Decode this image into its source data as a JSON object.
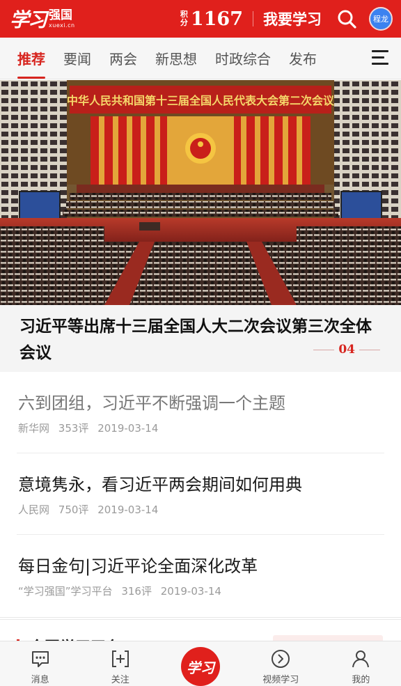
{
  "header": {
    "logo_script": "学习",
    "logo_main": "强国",
    "logo_sub": "xuexi.cn",
    "points_label_1": "积",
    "points_label_2": "分",
    "points_value": "1167",
    "study_label": "我要学习",
    "avatar_text": "程龙"
  },
  "tabs": [
    {
      "label": "推荐",
      "active": true
    },
    {
      "label": "要闻",
      "active": false
    },
    {
      "label": "两会",
      "active": false
    },
    {
      "label": "新思想",
      "active": false
    },
    {
      "label": "时政综合",
      "active": false
    },
    {
      "label": "发布",
      "active": false
    }
  ],
  "hero": {
    "banner_text": "中华人民共和国第十三届全国人民代表大会第二次会议",
    "title": "习近平等出席十三届全国人大二次会议第三次全体会议",
    "index": "04"
  },
  "news": [
    {
      "title": "六到团组，习近平不断强调一个主题",
      "source": "新华网",
      "comments": "353评",
      "date": "2019-03-14",
      "read": true
    },
    {
      "title": "意境隽永，看习近平两会期间如何用典",
      "source": "人民网",
      "comments": "750评",
      "date": "2019-03-14",
      "read": false
    },
    {
      "title": "每日金句|习近平论全面深化改革",
      "source": "“学习强国”学习平台",
      "comments": "316评",
      "date": "2019-03-14",
      "read": false
    }
  ],
  "section_peek": {
    "title": "全国学习平台"
  },
  "bottom_nav": {
    "messages": "消息",
    "follow": "关注",
    "center": "学习",
    "video": "视频学习",
    "mine": "我的"
  },
  "colors": {
    "brand_red": "#e0201c",
    "active_tab": "#d7251f",
    "avatar_blue": "#3b82f0"
  }
}
